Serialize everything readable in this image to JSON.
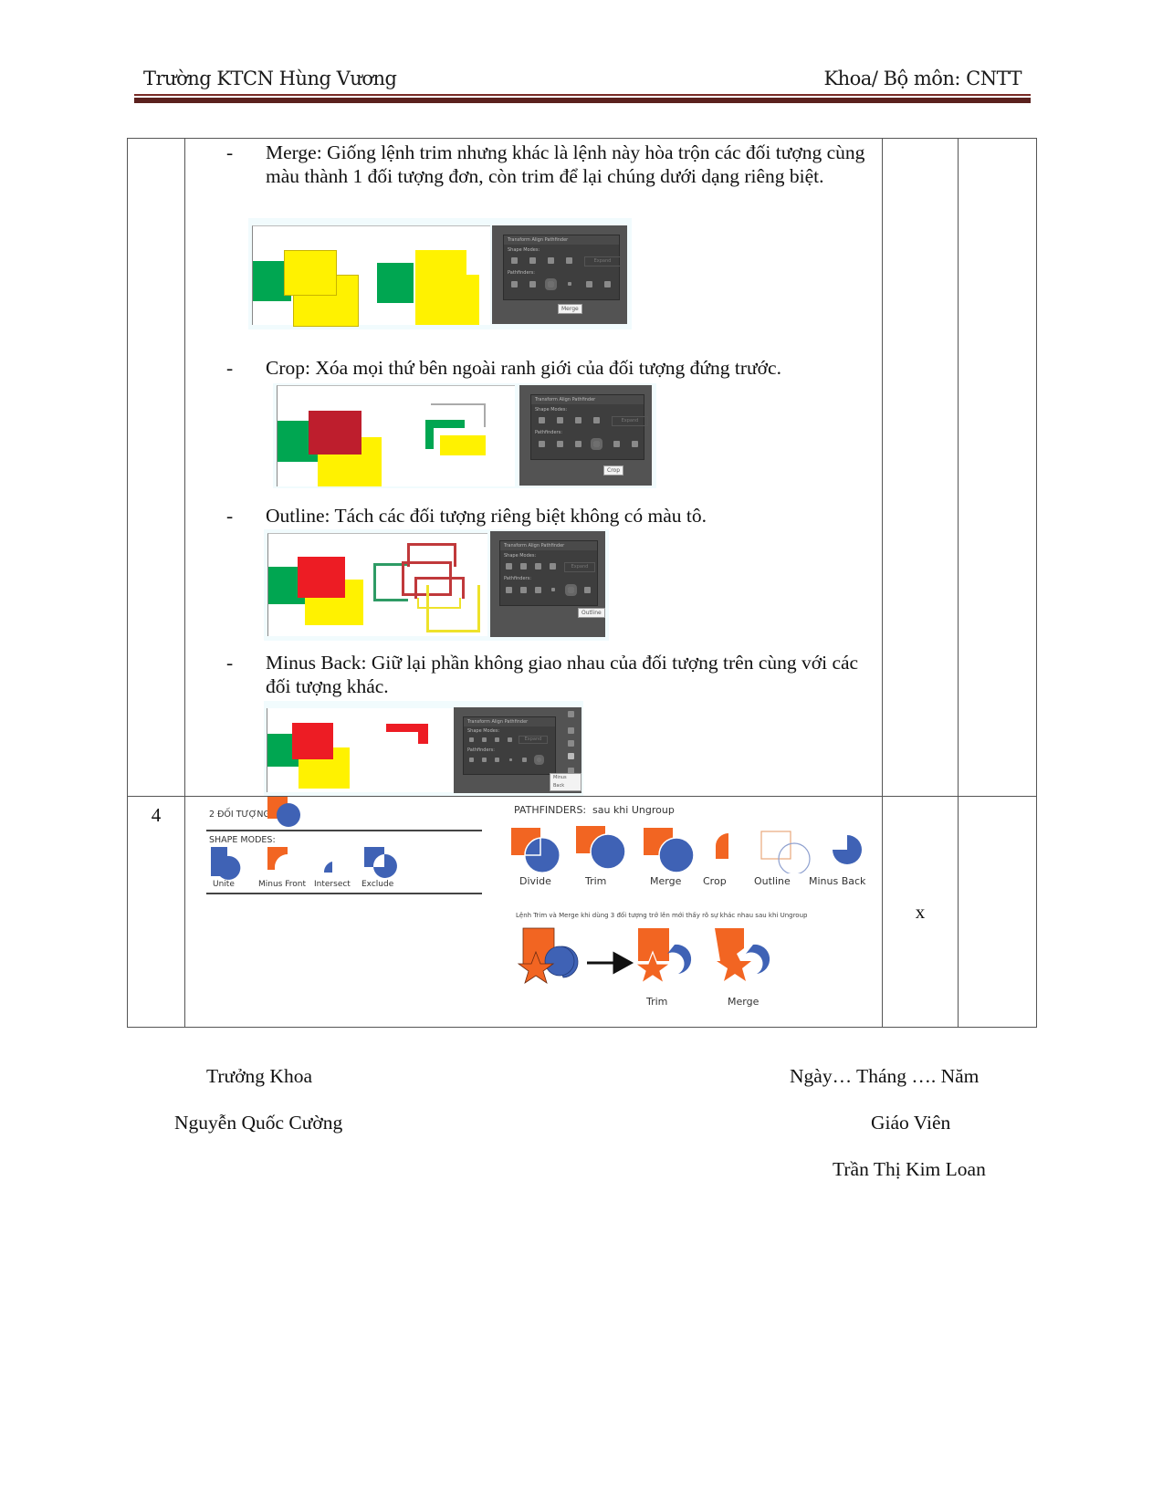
{
  "header": {
    "school": "Trường KTCN Hùng Vương",
    "department": "Khoa/ Bộ môn: CNTT"
  },
  "table": {
    "row1": {
      "items": [
        {
          "dash": "-",
          "text": "Merge: Giống lệnh trim nhưng khác là lệnh này hòa trộn các đối tượng cùng màu thành 1 đối tượng đơn, còn trim để lại chúng dưới dạng riêng biệt.",
          "tooltip": "Merge"
        },
        {
          "dash": "-",
          "text": "Crop: Xóa mọi thứ bên ngoài ranh giới của đối tượng đứng trước.",
          "tooltip": "Crop"
        },
        {
          "dash": "-",
          "text": "Outline: Tách các đối tượng riêng biệt không có màu tô.",
          "tooltip": "Outline"
        },
        {
          "dash": "-",
          "text": "Minus Back: Giữ lại phần không giao nhau của đối tượng trên cùng với các đối tượng khác.",
          "tooltip": "Minus Back"
        }
      ],
      "panel": {
        "tabs": "Transform   Align   Pathfinder",
        "shape_modes": "Shape Modes:",
        "pathfinders": "Pathfinders:",
        "expand": "Expand"
      }
    },
    "row2": {
      "number": "4",
      "mark": "x",
      "two_objects": "2 ĐỐI TƯỢNG",
      "shape_modes_title": "SHAPE MODES:",
      "shape_modes": [
        "Unite",
        "Minus Front",
        "Intersect",
        "Exclude"
      ],
      "pathfinders_title": "PATHFINDERS:",
      "pathfinders_subtitle": "sau khi Ungroup",
      "pathfinders": [
        "Divide",
        "Trim",
        "Merge",
        "Crop",
        "Outline",
        "Minus Back"
      ],
      "note": "Lệnh Trim và Merge khi dùng 3 đối tượng trở lên mới thấy rõ sự khác nhau sau khi Ungroup",
      "result_labels": [
        "Trim",
        "Merge"
      ]
    }
  },
  "colors": {
    "green": "#00a651",
    "yellow": "#fff200",
    "red": "#ed1c24",
    "dark_red": "#be1e2d",
    "orange": "#f26522",
    "blue": "#3f62b5",
    "header_rule": "#5b211e"
  },
  "footer": {
    "left_title": "Trưởng Khoa",
    "left_name": "Nguyễn Quốc Cường",
    "right_date": "Ngày… Tháng …. Năm",
    "right_title": "Giáo Viên",
    "right_name": "Trần Thị Kim Loan"
  }
}
